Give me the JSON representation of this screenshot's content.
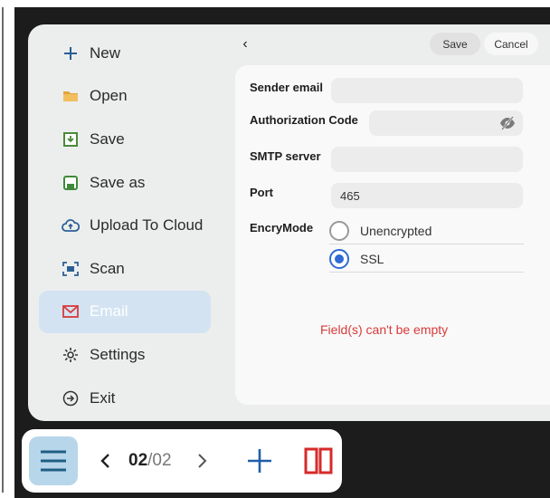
{
  "menu": {
    "items": [
      {
        "label": "New",
        "icon": "plus-icon",
        "active": false
      },
      {
        "label": "Open",
        "icon": "folder-icon",
        "active": false
      },
      {
        "label": "Save",
        "icon": "save-icon",
        "active": false
      },
      {
        "label": "Save as",
        "icon": "save-as-icon",
        "active": false
      },
      {
        "label": "Upload To Cloud",
        "icon": "cloud-upload-icon",
        "active": false
      },
      {
        "label": "Scan",
        "icon": "scan-icon",
        "active": false
      },
      {
        "label": "Email",
        "icon": "email-icon",
        "active": true
      },
      {
        "label": "Settings",
        "icon": "gear-icon",
        "active": false
      },
      {
        "label": "Exit",
        "icon": "exit-icon",
        "active": false
      }
    ]
  },
  "header": {
    "back_glyph": "‹",
    "save_label": "Save",
    "cancel_label": "Cancel"
  },
  "form": {
    "sender_email": {
      "label": "Sender email",
      "value": ""
    },
    "auth_code": {
      "label": "Authorization Code",
      "value": ""
    },
    "smtp_server": {
      "label": "SMTP server",
      "value": ""
    },
    "port": {
      "label": "Port",
      "value": "465"
    },
    "encry_mode": {
      "label": "EncryMode",
      "options": [
        "Unencrypted",
        "SSL"
      ],
      "selected": "SSL"
    },
    "error": "Field(s) can't be empty"
  },
  "toolbar": {
    "page_current": "02",
    "page_separator": "/",
    "page_total": "02"
  },
  "colors": {
    "accent": "#2f6bd6",
    "active_menu_bg": "#d3e3f2",
    "error": "#d93a3a",
    "split_icon": "#d62a2a",
    "plus_icon": "#1f5fa8"
  }
}
